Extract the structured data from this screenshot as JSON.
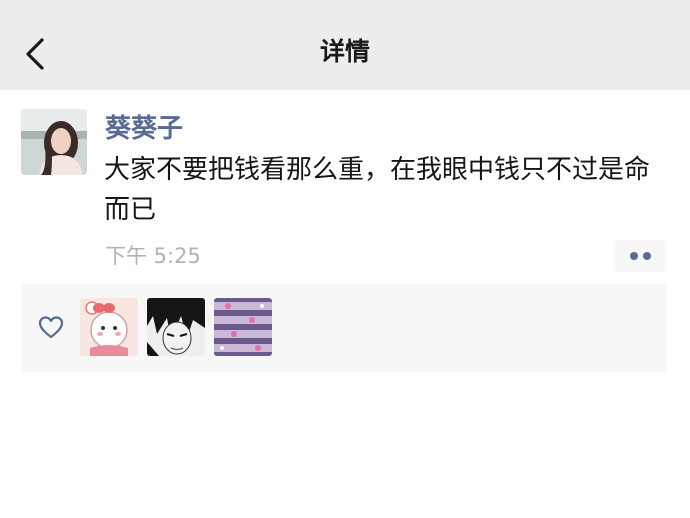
{
  "header": {
    "title": "详情"
  },
  "post": {
    "username": "葵葵子",
    "content": "大家不要把钱看那么重，在我眼中钱只不过是命而已",
    "time": "下午 5:25"
  },
  "colors": {
    "header_bg": "#ededed",
    "link_blue": "#576b95",
    "timestamp_gray": "#b2b2b2",
    "likes_bg": "#f7f7f7"
  },
  "icons": {
    "back": "chevron-left-icon",
    "more": "two-dots-icon",
    "like": "heart-outline-icon"
  }
}
